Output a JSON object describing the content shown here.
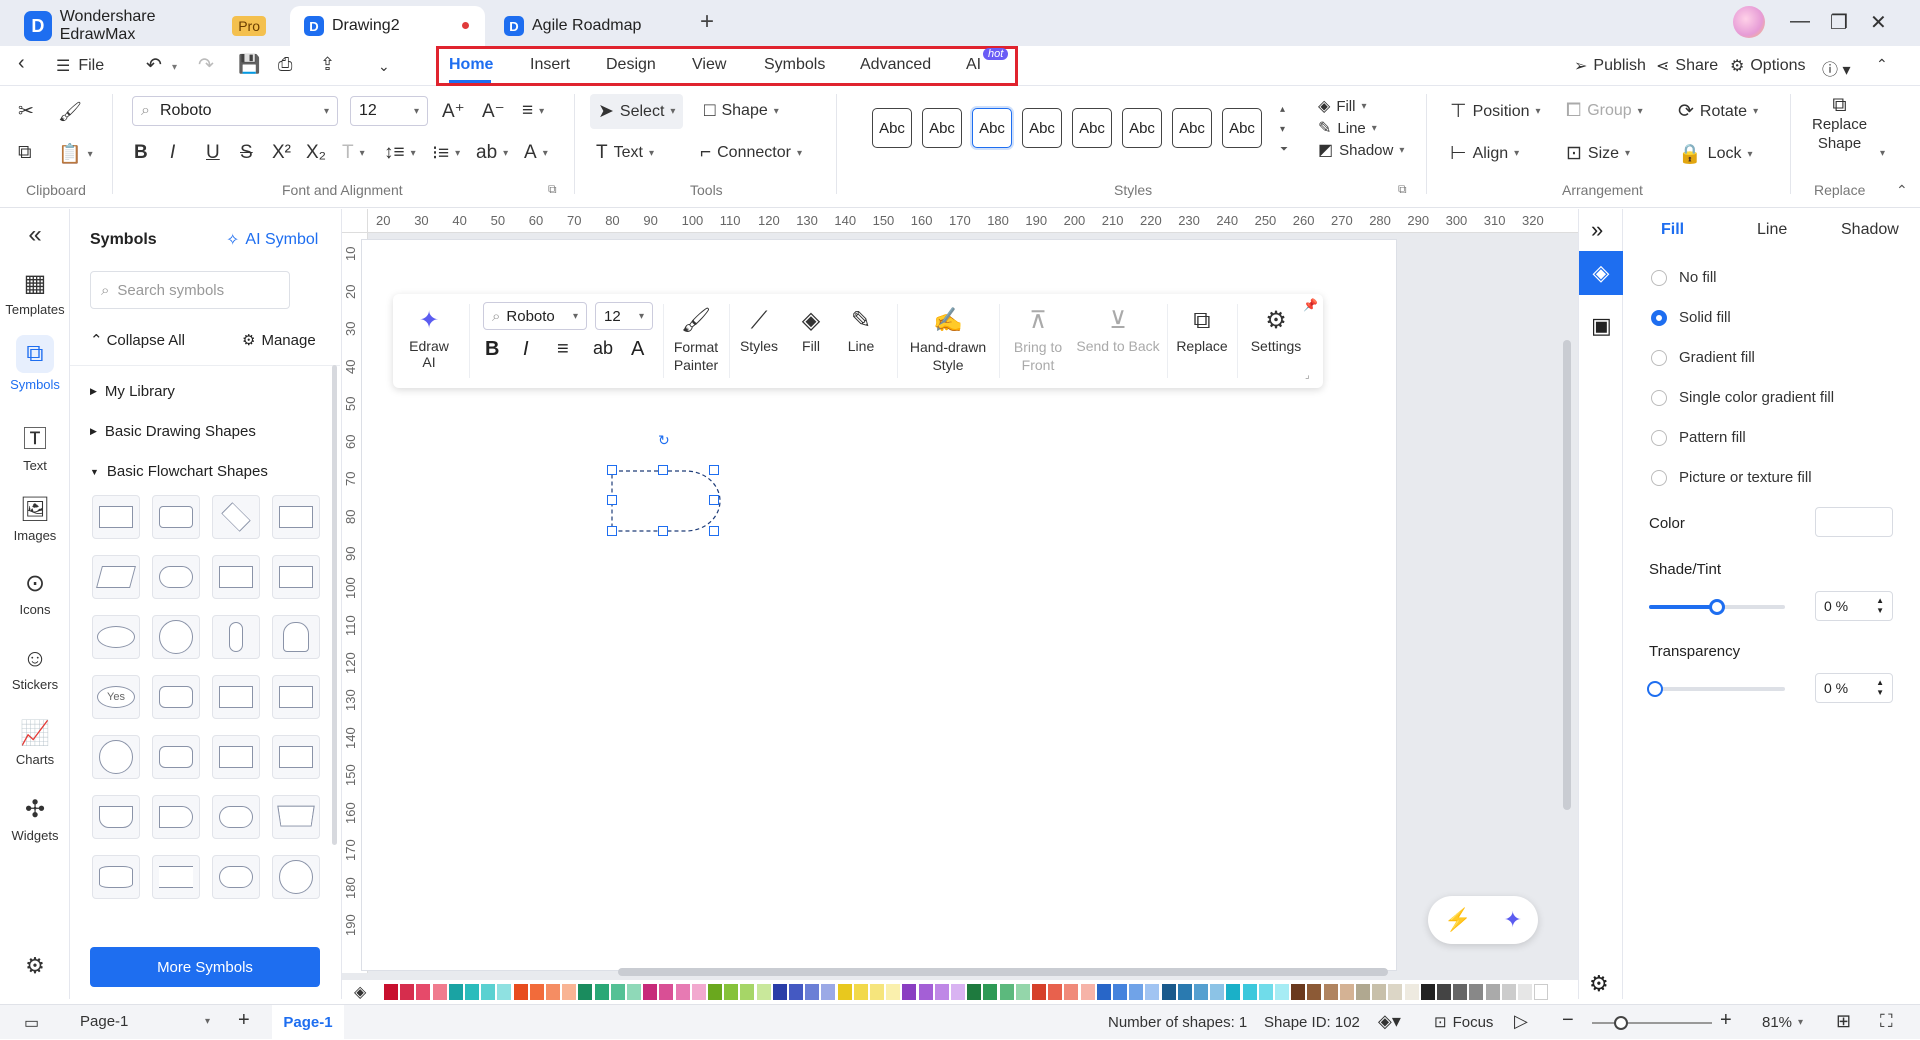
{
  "titlebar": {
    "app_name": "Wondershare EdrawMax",
    "pro_badge": "Pro",
    "tab_active": "Drawing2",
    "tab_other": "Agile Roadmap",
    "new_tab": "+"
  },
  "menubar": {
    "file": "File",
    "tabs": [
      "Home",
      "Insert",
      "Design",
      "View",
      "Symbols",
      "Advanced",
      "AI"
    ],
    "ai_badge": "hot",
    "right": {
      "publish": "Publish",
      "share": "Share",
      "options": "Options"
    },
    "highlight_color": "#e0232e"
  },
  "ribbon": {
    "clipboard_label": "Clipboard",
    "font_label": "Font and Alignment",
    "font_name": "Roboto",
    "font_size": "12",
    "tools_label": "Tools",
    "select": "Select",
    "shape": "Shape",
    "text": "Text",
    "connector": "Connector",
    "styles_label": "Styles",
    "abc_samples": [
      "Abc",
      "Abc",
      "Abc",
      "Abc",
      "Abc",
      "Abc",
      "Abc",
      "Abc"
    ],
    "fill": "Fill",
    "line": "Line",
    "shadow": "Shadow",
    "arrangement_label": "Arrangement",
    "position": "Position",
    "group": "Group",
    "rotate": "Rotate",
    "align": "Align",
    "size": "Size",
    "lock": "Lock",
    "replace_label": "Replace",
    "replace_shape": [
      "Replace",
      "Shape"
    ]
  },
  "leftnav": {
    "items": [
      "Templates",
      "Symbols",
      "Text",
      "Images",
      "Icons",
      "Stickers",
      "Charts",
      "Widgets"
    ]
  },
  "symbols_panel": {
    "title": "Symbols",
    "ai_symbol": "AI Symbol",
    "search_placeholder": "Search symbols",
    "collapse_all": "Collapse All",
    "manage": "Manage",
    "categories": [
      "My Library",
      "Basic Drawing Shapes",
      "Basic Flowchart Shapes"
    ],
    "yes_shape": "Yes",
    "more_symbols": "More Symbols"
  },
  "rulers": {
    "h_ticks": [
      "20",
      "30",
      "40",
      "50",
      "60",
      "70",
      "80",
      "90",
      "100",
      "110",
      "120",
      "130",
      "140",
      "150",
      "160",
      "170",
      "180",
      "190",
      "200",
      "210",
      "220",
      "230",
      "240",
      "250",
      "260",
      "270",
      "280",
      "290",
      "300",
      "310",
      "320"
    ],
    "v_ticks": [
      "10",
      "20",
      "30",
      "40",
      "50",
      "60",
      "70",
      "80",
      "90",
      "100",
      "110",
      "120",
      "130",
      "140",
      "150",
      "160",
      "170",
      "180",
      "190"
    ]
  },
  "floatbar": {
    "font_name": "Roboto",
    "font_size": "12",
    "edraw_ai": "Edraw AI",
    "format_painter": [
      "Format",
      "Painter"
    ],
    "styles": "Styles",
    "fill": "Fill",
    "line": "Line",
    "hand_drawn": [
      "Hand-drawn",
      "Style"
    ],
    "bring_front": [
      "Bring to",
      "Front"
    ],
    "send_back": "Send to Back",
    "replace": "Replace",
    "settings": "Settings"
  },
  "rightpanel": {
    "tabs": [
      "Fill",
      "Line",
      "Shadow"
    ],
    "options": [
      "No fill",
      "Solid fill",
      "Gradient fill",
      "Single color gradient fill",
      "Pattern fill",
      "Picture or texture fill"
    ],
    "selected": "Solid fill",
    "color_label": "Color",
    "shade_label": "Shade/Tint",
    "shade_value": "0 %",
    "transparency_label": "Transparency",
    "transparency_value": "0 %",
    "shade_slider": 0.5,
    "transparency_slider": 0
  },
  "statusbar": {
    "page_select": "Page-1",
    "page_tab": "Page-1",
    "shape_count": "Number of shapes: 1",
    "shape_id": "Shape ID: 102",
    "focus": "Focus",
    "zoom": "81%"
  },
  "palette": [
    "#c8102e",
    "#d62d4d",
    "#e64a6a",
    "#f07b8e",
    "#1aa3a3",
    "#2bbcbc",
    "#5ad1d1",
    "#8fe1e1",
    "#e84c1e",
    "#f26b3a",
    "#f58d63",
    "#f9b494",
    "#1a8c5e",
    "#2aa876",
    "#54c195",
    "#8fd9b8",
    "#c72a7a",
    "#d94f95",
    "#e77ab3",
    "#f2a9cf",
    "#6aa81e",
    "#86c23a",
    "#a6d667",
    "#c9e89b",
    "#2a3ea8",
    "#4459c2",
    "#6b7fd6",
    "#9ba9e6",
    "#e8c81e",
    "#f2d94a",
    "#f6e57c",
    "#faf0ad",
    "#8a3ec2",
    "#a45fd6",
    "#bf87e6",
    "#d9b3f2",
    "#1e7a3e",
    "#2e9a55",
    "#5cb97d",
    "#94d6aa",
    "#d6402a",
    "#e8614d",
    "#f08a7a",
    "#f6b3a8",
    "#2866c8",
    "#4583dd",
    "#70a3e8",
    "#a1c4f2",
    "#1a5a8c",
    "#2a7ab0",
    "#55a0d0",
    "#8cc3e6",
    "#1ab0c8",
    "#3cc8dc",
    "#70dcea",
    "#a6ecf4",
    "#6b3a1e",
    "#8c5a36",
    "#b08460",
    "#d4b294",
    "#b0a890",
    "#c8c0aa",
    "#dcd6c6",
    "#eeeae0",
    "#222222",
    "#444444",
    "#666666",
    "#888888",
    "#aaaaaa",
    "#cccccc",
    "#e6e6e6",
    "#ffffff"
  ]
}
